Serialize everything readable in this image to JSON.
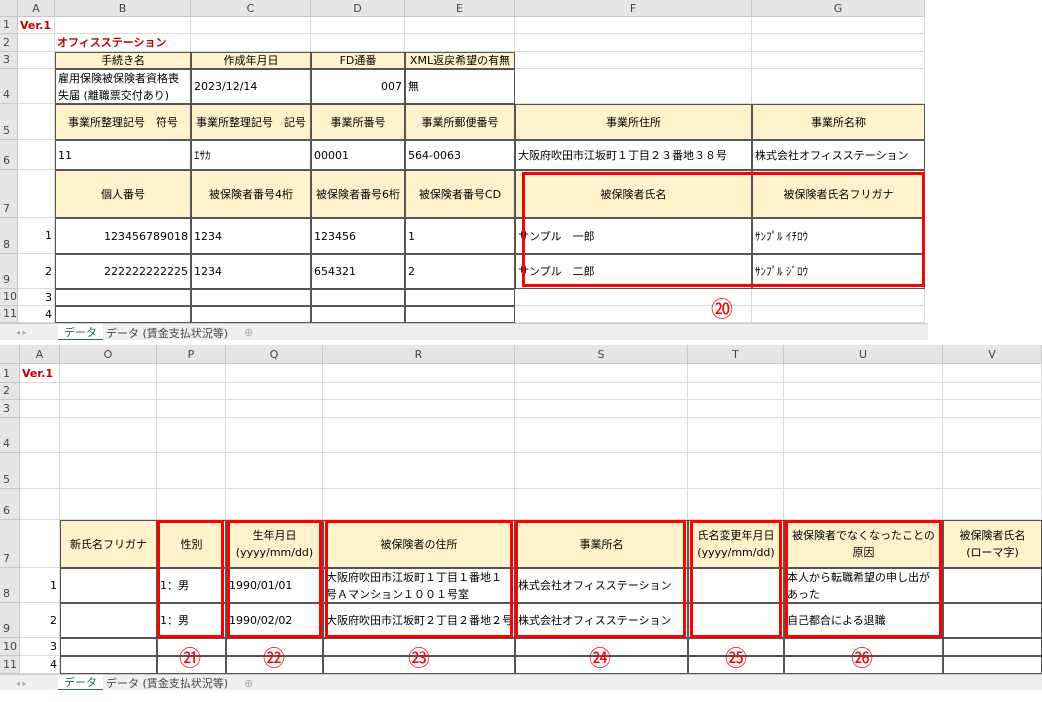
{
  "sheets": [
    {
      "columns": [
        "A",
        "B",
        "C",
        "D",
        "E",
        "F",
        "G"
      ],
      "rows": [
        "1",
        "2",
        "3",
        "4",
        "5",
        "6",
        "7",
        "8",
        "9",
        "10",
        "11"
      ],
      "cells": [
        {
          "r": 1,
          "c": "A",
          "text": "Ver.1",
          "style": "redbold"
        },
        {
          "r": 2,
          "c": "B",
          "text": "オフィスステーション",
          "style": "redbold"
        },
        {
          "r": 3,
          "c": "B",
          "text": "手続き名",
          "style": "th"
        },
        {
          "r": 3,
          "c": "C",
          "text": "作成年月日",
          "style": "th"
        },
        {
          "r": 3,
          "c": "D",
          "text": "FD通番",
          "style": "th"
        },
        {
          "r": 3,
          "c": "E",
          "text": "XML返戻希望の有無",
          "style": "th"
        },
        {
          "r": 4,
          "c": "B",
          "text": "雇用保険被保険者資格喪失届 (離職票交付あり)",
          "style": "td wrap"
        },
        {
          "r": 4,
          "c": "C",
          "text": "2023/12/14",
          "style": "td"
        },
        {
          "r": 4,
          "c": "D",
          "text": "007",
          "style": "td right"
        },
        {
          "r": 4,
          "c": "E",
          "text": "無",
          "style": "td"
        },
        {
          "r": 5,
          "c": "B",
          "text": "事業所整理記号　符号",
          "style": "th"
        },
        {
          "r": 5,
          "c": "C",
          "text": "事業所整理記号　記号",
          "style": "th"
        },
        {
          "r": 5,
          "c": "D",
          "text": "事業所番号",
          "style": "th"
        },
        {
          "r": 5,
          "c": "E",
          "text": "事業所郵便番号",
          "style": "th"
        },
        {
          "r": 5,
          "c": "F",
          "text": "事業所住所",
          "style": "th"
        },
        {
          "r": 5,
          "c": "G",
          "text": "事業所名称",
          "style": "th"
        },
        {
          "r": 6,
          "c": "B",
          "text": "11",
          "style": "td"
        },
        {
          "r": 6,
          "c": "C",
          "text": "ｴｻｶ",
          "style": "td"
        },
        {
          "r": 6,
          "c": "D",
          "text": "00001",
          "style": "td"
        },
        {
          "r": 6,
          "c": "E",
          "text": "564-0063",
          "style": "td"
        },
        {
          "r": 6,
          "c": "F",
          "text": "大阪府吹田市江坂町１丁目２３番地３８号",
          "style": "td"
        },
        {
          "r": 6,
          "c": "G",
          "text": "株式会社オフィスステーション",
          "style": "td"
        },
        {
          "r": 7,
          "c": "B",
          "text": "個人番号",
          "style": "th"
        },
        {
          "r": 7,
          "c": "C",
          "text": "被保険者番号4桁",
          "style": "th"
        },
        {
          "r": 7,
          "c": "D",
          "text": "被保険者番号6桁",
          "style": "th"
        },
        {
          "r": 7,
          "c": "E",
          "text": "被保険者番号CD",
          "style": "th"
        },
        {
          "r": 7,
          "c": "F",
          "text": "被保険者氏名",
          "style": "th"
        },
        {
          "r": 7,
          "c": "G",
          "text": "被保険者氏名フリガナ",
          "style": "th"
        },
        {
          "r": 8,
          "c": "A",
          "text": "1",
          "style": "right"
        },
        {
          "r": 8,
          "c": "B",
          "text": "123456789018",
          "style": "td right"
        },
        {
          "r": 8,
          "c": "C",
          "text": "1234",
          "style": "td"
        },
        {
          "r": 8,
          "c": "D",
          "text": "123456",
          "style": "td"
        },
        {
          "r": 8,
          "c": "E",
          "text": "1",
          "style": "td"
        },
        {
          "r": 8,
          "c": "F",
          "text": "サンプル　一郎",
          "style": "td"
        },
        {
          "r": 8,
          "c": "G",
          "text": "ｻﾝﾌﾟﾙ ｲﾁﾛｳ",
          "style": "td"
        },
        {
          "r": 9,
          "c": "A",
          "text": "2",
          "style": "right"
        },
        {
          "r": 9,
          "c": "B",
          "text": "222222222225",
          "style": "td right"
        },
        {
          "r": 9,
          "c": "C",
          "text": "1234",
          "style": "td"
        },
        {
          "r": 9,
          "c": "D",
          "text": "654321",
          "style": "td"
        },
        {
          "r": 9,
          "c": "E",
          "text": "2",
          "style": "td"
        },
        {
          "r": 9,
          "c": "F",
          "text": "サンプル　二郎",
          "style": "td"
        },
        {
          "r": 9,
          "c": "G",
          "text": "ｻﾝﾌﾟﾙ ｼﾞﾛｳ",
          "style": "td"
        },
        {
          "r": 10,
          "c": "A",
          "text": "3",
          "style": "right"
        },
        {
          "r": 10,
          "c": "B",
          "text": "",
          "style": "td"
        },
        {
          "r": 10,
          "c": "C",
          "text": "",
          "style": "td"
        },
        {
          "r": 10,
          "c": "D",
          "text": "",
          "style": "td"
        },
        {
          "r": 10,
          "c": "E",
          "text": "",
          "style": "td"
        },
        {
          "r": 11,
          "c": "A",
          "text": "4",
          "style": "right"
        },
        {
          "r": 11,
          "c": "B",
          "text": "",
          "style": "td"
        },
        {
          "r": 11,
          "c": "C",
          "text": "",
          "style": "td"
        },
        {
          "r": 11,
          "c": "D",
          "text": "",
          "style": "td"
        },
        {
          "r": 11,
          "c": "E",
          "text": "",
          "style": "td"
        }
      ],
      "tabs": [
        "データ",
        "データ (賃金支払状況等)"
      ],
      "add_sheet_icon": "plus-circle-icon",
      "annotations": [
        "⑳"
      ]
    },
    {
      "columns": [
        "A",
        "O",
        "P",
        "Q",
        "R",
        "S",
        "T",
        "U",
        "V"
      ],
      "rows": [
        "1",
        "2",
        "3",
        "4",
        "5",
        "6",
        "7",
        "8",
        "9",
        "10",
        "11"
      ],
      "cells": [
        {
          "r": 1,
          "c": "A",
          "text": "Ver.1",
          "style": "redbold"
        },
        {
          "r": 7,
          "c": "O",
          "text": "新氏名フリガナ",
          "style": "th"
        },
        {
          "r": 7,
          "c": "P",
          "text": "性別",
          "style": "th"
        },
        {
          "r": 7,
          "c": "Q",
          "text": "生年月日\n(yyyy/mm/dd)",
          "style": "th"
        },
        {
          "r": 7,
          "c": "R",
          "text": "被保険者の住所",
          "style": "th"
        },
        {
          "r": 7,
          "c": "S",
          "text": "事業所名",
          "style": "th"
        },
        {
          "r": 7,
          "c": "T",
          "text": "氏名変更年月日\n(yyyy/mm/dd)",
          "style": "th"
        },
        {
          "r": 7,
          "c": "U",
          "text": "被保険者でなくなったことの原因",
          "style": "th wrap"
        },
        {
          "r": 7,
          "c": "V",
          "text": "被保険者氏名\n(ローマ字)",
          "style": "th"
        },
        {
          "r": 8,
          "c": "A",
          "text": "1",
          "style": "right"
        },
        {
          "r": 8,
          "c": "O",
          "text": "",
          "style": "td"
        },
        {
          "r": 8,
          "c": "P",
          "text": "1：男",
          "style": "td"
        },
        {
          "r": 8,
          "c": "Q",
          "text": "1990/01/01",
          "style": "td"
        },
        {
          "r": 8,
          "c": "R",
          "text": "大阪府吹田市江坂町１丁目１番地１号Ａマンション１００１号室",
          "style": "td wrap"
        },
        {
          "r": 8,
          "c": "S",
          "text": "株式会社オフィスステーション",
          "style": "td"
        },
        {
          "r": 8,
          "c": "T",
          "text": "",
          "style": "td"
        },
        {
          "r": 8,
          "c": "U",
          "text": "本人から転職希望の申し出があった",
          "style": "td wrap"
        },
        {
          "r": 8,
          "c": "V",
          "text": "",
          "style": "td"
        },
        {
          "r": 9,
          "c": "A",
          "text": "2",
          "style": "right"
        },
        {
          "r": 9,
          "c": "O",
          "text": "",
          "style": "td"
        },
        {
          "r": 9,
          "c": "P",
          "text": "1：男",
          "style": "td"
        },
        {
          "r": 9,
          "c": "Q",
          "text": "1990/02/02",
          "style": "td"
        },
        {
          "r": 9,
          "c": "R",
          "text": "大阪府吹田市江坂町２丁目２番地２号",
          "style": "td"
        },
        {
          "r": 9,
          "c": "S",
          "text": "株式会社オフィスステーション",
          "style": "td"
        },
        {
          "r": 9,
          "c": "T",
          "text": "",
          "style": "td"
        },
        {
          "r": 9,
          "c": "U",
          "text": "自己都合による退職",
          "style": "td"
        },
        {
          "r": 9,
          "c": "V",
          "text": "",
          "style": "td"
        },
        {
          "r": 10,
          "c": "A",
          "text": "3",
          "style": "right"
        },
        {
          "r": 10,
          "c": "O",
          "text": "",
          "style": "td"
        },
        {
          "r": 10,
          "c": "P",
          "text": "",
          "style": "td"
        },
        {
          "r": 10,
          "c": "Q",
          "text": "",
          "style": "td"
        },
        {
          "r": 10,
          "c": "R",
          "text": "",
          "style": "td"
        },
        {
          "r": 10,
          "c": "S",
          "text": "",
          "style": "td"
        },
        {
          "r": 10,
          "c": "T",
          "text": "",
          "style": "td"
        },
        {
          "r": 10,
          "c": "U",
          "text": "",
          "style": "td"
        },
        {
          "r": 10,
          "c": "V",
          "text": "",
          "style": "td"
        },
        {
          "r": 11,
          "c": "A",
          "text": "4",
          "style": "right"
        },
        {
          "r": 11,
          "c": "O",
          "text": "",
          "style": "td"
        },
        {
          "r": 11,
          "c": "P",
          "text": "",
          "style": "td"
        },
        {
          "r": 11,
          "c": "Q",
          "text": "",
          "style": "td"
        },
        {
          "r": 11,
          "c": "R",
          "text": "",
          "style": "td"
        },
        {
          "r": 11,
          "c": "S",
          "text": "",
          "style": "td"
        },
        {
          "r": 11,
          "c": "T",
          "text": "",
          "style": "td"
        },
        {
          "r": 11,
          "c": "U",
          "text": "",
          "style": "td"
        },
        {
          "r": 11,
          "c": "V",
          "text": "",
          "style": "td"
        }
      ],
      "tabs": [
        "データ",
        "データ (賃金支払状況等)"
      ],
      "add_sheet_icon": "plus-circle-icon",
      "annotations": [
        "㉑",
        "㉒",
        "㉓",
        "㉔",
        "㉕",
        "㉖"
      ]
    }
  ]
}
